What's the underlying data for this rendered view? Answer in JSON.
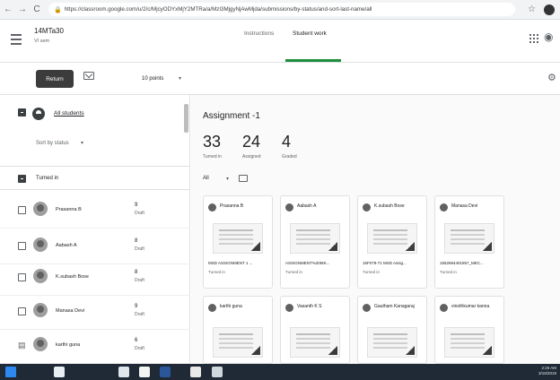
{
  "browser": {
    "url": "https://classroom.google.com/u/2/c/MjcyODYxMjY2MTRa/a/MzI3MjgyNjAwMjda/submissions/by-status/and-sort-last-name/all",
    "nav_back": "←",
    "nav_forward": "→",
    "nav_reload": "C"
  },
  "header": {
    "class_name": "14MTa30",
    "class_section": "VI sem",
    "tabs": [
      "Instructions",
      "Student work"
    ],
    "active_tab": "Student work"
  },
  "toolbar": {
    "return_label": "Return",
    "points": "10 points"
  },
  "roster": {
    "all_students_label": "All students",
    "sort_label": "Sort by status",
    "section_label": "Turned in",
    "students": [
      {
        "name": "Prasanna  B",
        "grade": "9",
        "status": "Draft"
      },
      {
        "name": "Aabash A",
        "grade": "8",
        "status": "Draft"
      },
      {
        "name": "K.subash Bose",
        "grade": "8",
        "status": "Draft"
      },
      {
        "name": "Manasa Devi",
        "grade": "9",
        "status": "Draft"
      },
      {
        "name": "karthi guna",
        "grade": "6",
        "status": "Draft"
      }
    ]
  },
  "assignment": {
    "title": "Assignment -1",
    "stats": [
      {
        "value": "33",
        "label": "Turned in"
      },
      {
        "value": "24",
        "label": "Assigned"
      },
      {
        "value": "4",
        "label": "Graded"
      }
    ],
    "filter": "All"
  },
  "cards": [
    {
      "name": "Prasanna  B",
      "file": "MSD ASSIGNMENT 1 ...",
      "status": "Turned in"
    },
    {
      "name": "Aabash A",
      "file": "ASSIGNMENT%20MS...",
      "status": "Turned in"
    },
    {
      "name": "K.subash Bose",
      "file": "16F079-71 MSD Assig...",
      "status": "Turned in"
    },
    {
      "name": "Manasa Devi",
      "file": "1552694401857_MEC...",
      "status": "Turned in"
    },
    {
      "name": "karthi guna",
      "file": "",
      "status": ""
    },
    {
      "name": "Vasanth K S",
      "file": "",
      "status": ""
    },
    {
      "name": "Gautham Kanagaraj",
      "file": "",
      "status": ""
    },
    {
      "name": "vinothkumar kanna",
      "file": "",
      "status": ""
    }
  ],
  "taskbar": {
    "time": "2:26 AM",
    "date": "3/18/2019"
  },
  "icons": {
    "menu": "hamburger-icon",
    "email": "email-icon",
    "settings": "gear-icon",
    "apps": "apps-grid-icon",
    "folder": "folder-icon"
  },
  "colors": {
    "accent": "#1e8e3e",
    "return_button": "#3c3c3c",
    "taskbar": "#1f2a36"
  }
}
